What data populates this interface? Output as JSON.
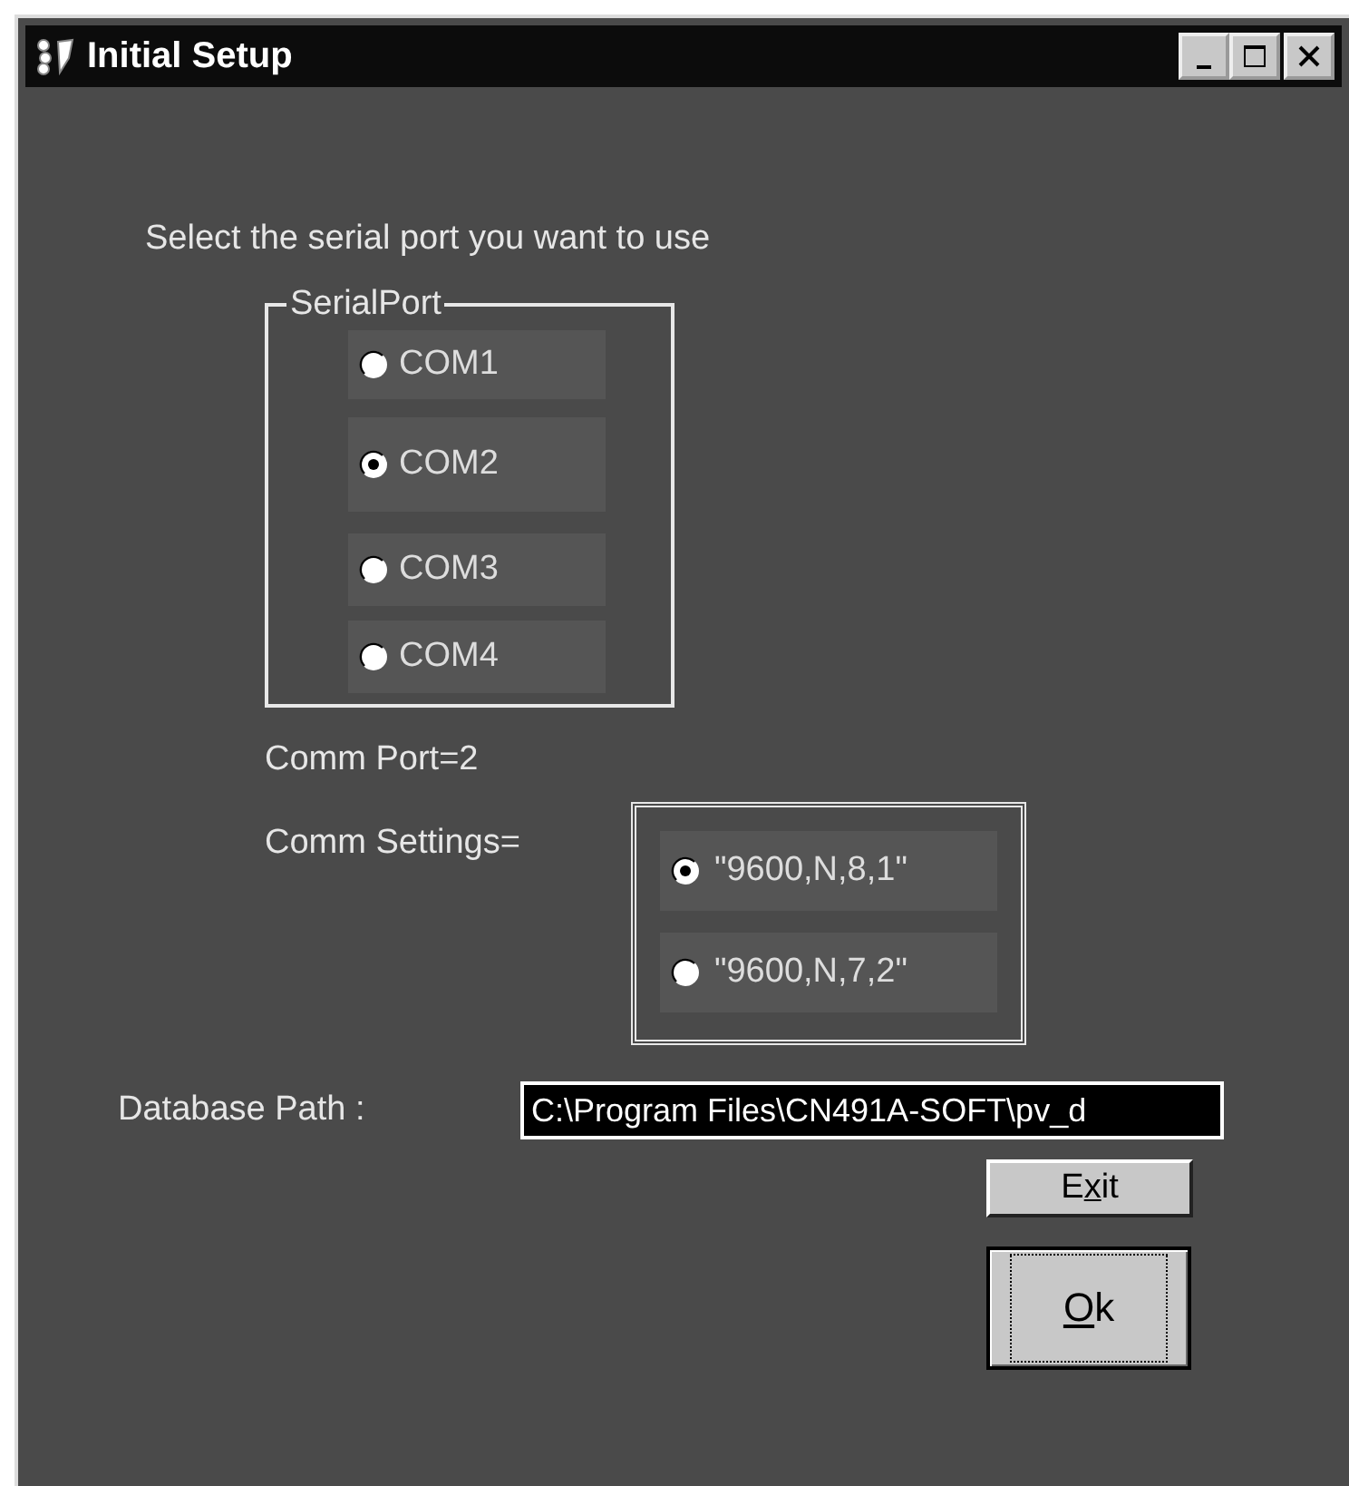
{
  "window": {
    "title": "Initial Setup"
  },
  "prompt": "Select the serial port you want to use",
  "serial_port": {
    "label": "SerialPort",
    "options": [
      {
        "label": "COM1",
        "selected": false
      },
      {
        "label": "COM2",
        "selected": true
      },
      {
        "label": "COM3",
        "selected": false
      },
      {
        "label": "COM4",
        "selected": false
      }
    ]
  },
  "comm_port": "Comm Port=2",
  "comm_settings": {
    "label": "Comm Settings=",
    "options": [
      {
        "label": "\"9600,N,8,1\"",
        "selected": true
      },
      {
        "label": "\"9600,N,7,2\"",
        "selected": false
      }
    ]
  },
  "database_path": {
    "label": "Database Path :",
    "value": "C:\\Program Files\\CN491A-SOFT\\pv_d"
  },
  "buttons": [
    {
      "kind": "small",
      "before": "E",
      "key": "x",
      "after": "it",
      "focused": false
    },
    {
      "kind": "large",
      "key": "O",
      "after": "k",
      "focused": true
    }
  ]
}
